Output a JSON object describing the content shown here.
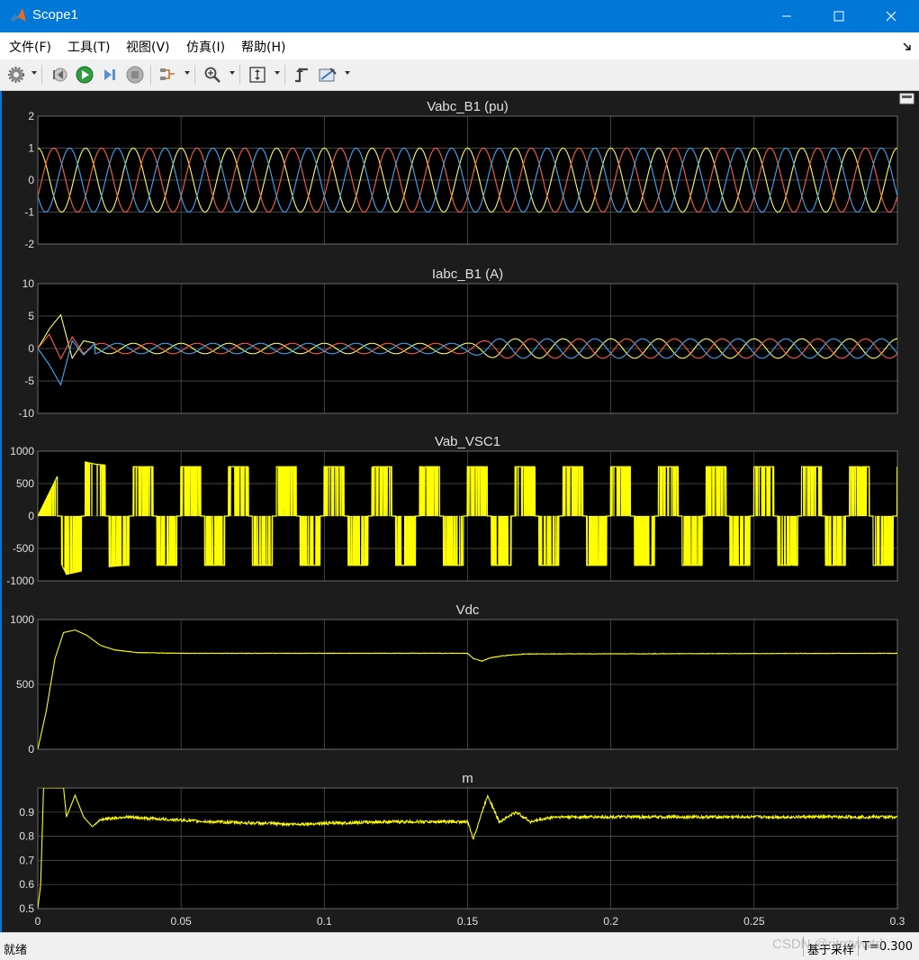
{
  "window": {
    "title": "Scope1",
    "controls": [
      "minimize",
      "maximize",
      "close"
    ]
  },
  "menu": {
    "items": [
      "文件(F)",
      "工具(T)",
      "视图(V)",
      "仿真(I)",
      "帮助(H)"
    ]
  },
  "toolbar": {
    "icons": [
      "settings-icon",
      "step-back-icon",
      "run-icon",
      "step-forward-icon",
      "stop-icon",
      "signal-select-icon",
      "zoom-icon",
      "autoscale-icon",
      "trigger-icon",
      "measure-icon"
    ]
  },
  "status": {
    "text": "就绪",
    "sample_mode": "基于采样",
    "time": "T=0.300"
  },
  "watermark": "CSDN @ritrrtwwtd",
  "colors": {
    "background": "#1c1c1c",
    "plot_background": "#000000",
    "grid": "#5a5a5a",
    "axes_text": "#e0e0e0",
    "phase_a": "#ffff5a",
    "phase_b": "#ff6040",
    "phase_c": "#3fa9f5",
    "single": "#ffff00"
  },
  "chart_data": [
    {
      "type": "line",
      "title": "Vabc_B1 (pu)",
      "ylim": [
        -2,
        2
      ],
      "yticks": [
        -2,
        -1,
        0,
        1,
        2
      ],
      "xlim": [
        0,
        0.3
      ],
      "grid": true,
      "series": [
        {
          "color": "#ffff5a",
          "amplitude": 1.0,
          "frequency_hz": 60,
          "phase_deg": 90
        },
        {
          "color": "#ff6040",
          "amplitude": 1.0,
          "frequency_hz": 60,
          "phase_deg": -30
        },
        {
          "color": "#3fa9f5",
          "amplitude": 1.0,
          "frequency_hz": 60,
          "phase_deg": 210
        }
      ]
    },
    {
      "type": "line",
      "title": "Iabc_B1 (A)",
      "ylim": [
        -10,
        10
      ],
      "yticks": [
        -10,
        -5,
        0,
        5,
        10
      ],
      "xlim": [
        0,
        0.3
      ],
      "grid": true,
      "series": [
        {
          "color": "#ffff5a",
          "points": [
            [
              0,
              0
            ],
            [
              0.004,
              3
            ],
            [
              0.008,
              5.2
            ],
            [
              0.012,
              -1.5
            ],
            [
              0.016,
              1.2
            ],
            [
              0.02,
              0.8
            ],
            [
              0.15,
              0.8
            ],
            [
              0.152,
              1.8
            ],
            [
              0.16,
              1.5
            ],
            [
              0.3,
              1.5
            ]
          ],
          "frequency_hz": 60
        },
        {
          "color": "#ff6040",
          "points": [
            [
              0,
              0
            ],
            [
              0.004,
              2.2
            ],
            [
              0.008,
              -1.6
            ],
            [
              0.012,
              1.8
            ],
            [
              0.016,
              -0.8
            ],
            [
              0.02,
              0.8
            ],
            [
              0.15,
              0.8
            ],
            [
              0.152,
              -2.5
            ],
            [
              0.16,
              1.5
            ],
            [
              0.3,
              1.5
            ]
          ],
          "frequency_hz": 60
        },
        {
          "color": "#3fa9f5",
          "points": [
            [
              0,
              0
            ],
            [
              0.004,
              -2.5
            ],
            [
              0.008,
              -5.6
            ],
            [
              0.012,
              1.2
            ],
            [
              0.016,
              -1.0
            ],
            [
              0.02,
              0.8
            ],
            [
              0.15,
              0.8
            ],
            [
              0.152,
              1.2
            ],
            [
              0.16,
              1.5
            ],
            [
              0.3,
              1.5
            ]
          ],
          "frequency_hz": 60
        }
      ]
    },
    {
      "type": "line",
      "title": "Vab_VSC1",
      "ylim": [
        -1000,
        1000
      ],
      "yticks": [
        -1000,
        -500,
        0,
        500,
        1000
      ],
      "xlim": [
        0,
        0.3
      ],
      "grid": true,
      "series": [
        {
          "color": "#ffff00",
          "pwm_frequency_hz": 60,
          "envelope": [
            [
              0,
              0
            ],
            [
              0.01,
              900
            ],
            [
              0.02,
              800
            ],
            [
              0.03,
              760
            ],
            [
              0.3,
              760
            ]
          ]
        }
      ]
    },
    {
      "type": "line",
      "title": "Vdc",
      "ylim": [
        0,
        1000
      ],
      "yticks": [
        0,
        500,
        1000
      ],
      "xlim": [
        0,
        0.3
      ],
      "grid": true,
      "series": [
        {
          "color": "#ffff00",
          "points": [
            [
              0,
              0
            ],
            [
              0.003,
              300
            ],
            [
              0.006,
              700
            ],
            [
              0.009,
              900
            ],
            [
              0.013,
              920
            ],
            [
              0.017,
              880
            ],
            [
              0.022,
              800
            ],
            [
              0.027,
              765
            ],
            [
              0.035,
              745
            ],
            [
              0.05,
              740
            ],
            [
              0.15,
              740
            ],
            [
              0.152,
              700
            ],
            [
              0.155,
              680
            ],
            [
              0.158,
              705
            ],
            [
              0.162,
              720
            ],
            [
              0.17,
              735
            ],
            [
              0.3,
              740
            ]
          ]
        }
      ]
    },
    {
      "type": "line",
      "title": "m",
      "ylim": [
        0.5,
        1.0
      ],
      "yticks": [
        0.5,
        0.6,
        0.7,
        0.8,
        0.9
      ],
      "xlim": [
        0,
        0.3
      ],
      "xticks": [
        0,
        0.05,
        0.1,
        0.15,
        0.2,
        0.25,
        0.3
      ],
      "grid": true,
      "series": [
        {
          "color": "#ffff00",
          "points": [
            [
              0,
              0.5
            ],
            [
              0.001,
              0.6
            ],
            [
              0.002,
              1.0
            ],
            [
              0.009,
              1.0
            ],
            [
              0.01,
              0.88
            ],
            [
              0.013,
              0.97
            ],
            [
              0.016,
              0.88
            ],
            [
              0.019,
              0.84
            ],
            [
              0.022,
              0.87
            ],
            [
              0.03,
              0.88
            ],
            [
              0.06,
              0.86
            ],
            [
              0.09,
              0.85
            ],
            [
              0.12,
              0.86
            ],
            [
              0.15,
              0.86
            ],
            [
              0.152,
              0.79
            ],
            [
              0.157,
              0.97
            ],
            [
              0.161,
              0.86
            ],
            [
              0.167,
              0.9
            ],
            [
              0.172,
              0.86
            ],
            [
              0.18,
              0.88
            ],
            [
              0.3,
              0.88
            ]
          ]
        }
      ]
    }
  ]
}
